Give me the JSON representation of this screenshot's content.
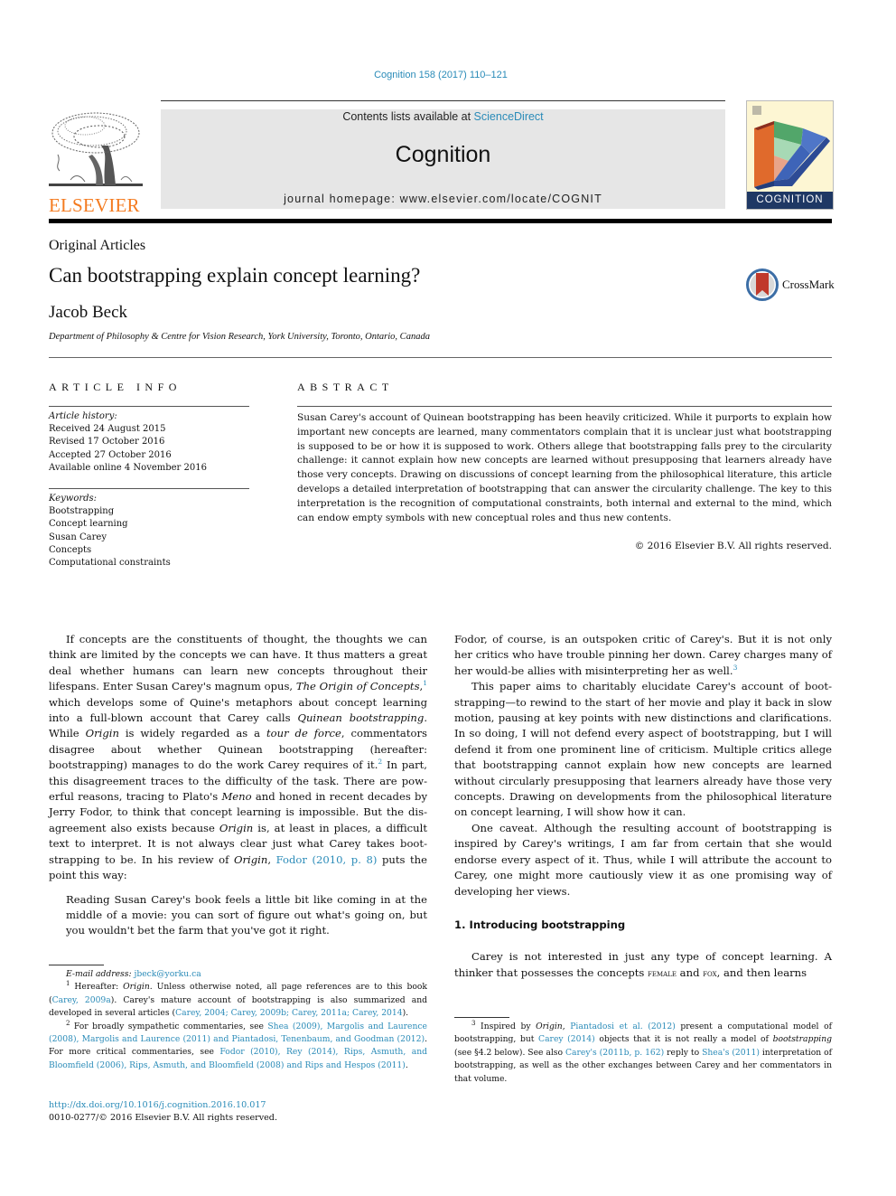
{
  "header": {
    "journal_ref": "Cognition 158 (2017) 110–121",
    "contents_prefix": "Contents lists available at ",
    "contents_link": "ScienceDirect",
    "journal_title": "Cognition",
    "homepage": "journal homepage: www.elsevier.com/locate/COGNIT",
    "publisher_logo_text": "ELSEVIER",
    "cover_label": "COGNITION",
    "colors": {
      "link": "#2a8bb8",
      "elsevier_orange": "#f47b20",
      "cover_navy": "#1f3864"
    }
  },
  "article": {
    "section_type": "Original Articles",
    "title": "Can bootstrapping explain concept learning?",
    "author": "Jacob Beck",
    "affiliation": "Department of Philosophy & Centre for Vision Research, York University, Toronto, Ontario, Canada",
    "crossmark_label": "CrossMark"
  },
  "article_info": {
    "heading": "ARTICLE INFO",
    "history_label": "Article history:",
    "history": [
      "Received 24 August 2015",
      "Revised 17 October 2016",
      "Accepted 27 October 2016",
      "Available online 4 November 2016"
    ],
    "keywords_label": "Keywords:",
    "keywords": [
      "Bootstrapping",
      "Concept learning",
      "Susan Carey",
      "Concepts",
      "Computational constraints"
    ]
  },
  "abstract": {
    "heading": "ABSTRACT",
    "text": "Susan Carey's account of Quinean bootstrapping has been heavily criticized. While it purports to explain how important new concepts are learned, many commentators complain that it is unclear just what boot­strapping is supposed to be or how it is supposed to work. Others allege that bootstrapping falls prey to the circularity challenge: it cannot explain how new concepts are learned without presupposing that learners already have those very concepts. Drawing on discussions of concept learning from the philo­sophical literature, this article develops a detailed interpretation of bootstrapping that can answer the circularity challenge. The key to this interpretation is the recognition of computational constraints, both internal and external to the mind, which can endow empty symbols with new conceptual roles and thus new contents.",
    "copyright": "© 2016 Elsevier B.V. All rights reserved."
  },
  "body": {
    "p1": {
      "a": "If concepts are the constituents of thought, the thoughts we can think are limited by the concepts we can have. It thus matters a great deal whether humans can learn new concepts throughout their lifespans. Enter Susan Carey's magnum opus, ",
      "b_i": "The Origin of Concepts",
      "c": ",",
      "fn1": "1",
      "d": " which develops some of Quine's metaphors about concept learning into a full-blown account that Carey calls ",
      "e_i": "Quinean bootstrap­ping",
      "f": ". While ",
      "g_i": "Origin",
      "h": " is widely regarded as a ",
      "i_i": "tour de force",
      "j": ", commenta­tors disagree about whether Quinean bootstrapping (hereafter: bootstrapping) manages to do the work Carey requires of it.",
      "fn2": "2",
      "k": " In part, this disagreement traces to the difficulty of the task. There are pow­erful reasons, tracing to Plato's ",
      "l_i": "Meno",
      "m": " and honed in recent decades by Jerry Fodor, to think that concept learning is impossible. But the dis­agreement also exists because ",
      "n_i": "Origin",
      "o": " is, at least in places, a difficult text to interpret. It is not always clear just what Carey takes boot­strapping to be. In his review of ",
      "p_i": "Origin",
      "q": ", ",
      "r_link": "Fodor (2010, p. 8)",
      "s": " puts the point this way:"
    },
    "quote": "Reading Susan Carey's book feels a little bit like coming in at the middle of a movie: you can sort of figure out what's going on, but you wouldn't bet the farm that you've got it right.",
    "p2": {
      "a": "Fodor, of course, is an outspoken critic of Carey's. But it is not only her critics who have trouble pinning her down. Carey charges many of her would-be allies with misinterpreting her as well.",
      "fn3": "3"
    },
    "p3": "This paper aims to charitably elucidate Carey's account of boot­strapping—to rewind to the start of her movie and play it back in slow motion, pausing at key points with new distinctions and clar­ifications. In so doing, I will not defend every aspect of bootstrap­ping, but I will defend it from one prominent line of criticism. Multiple critics allege that bootstrapping cannot explain how new concepts are learned without circularly presupposing that learners already have those very concepts. Drawing on develop­ments from the philosophical literature on concept learning, I will show how it can.",
    "p4": "One caveat. Although the resulting account of bootstrapping is inspired by Carey's writings, I am far from certain that she would endorse every aspect of it. Thus, while I will attribute the account to Carey, one might more cautiously view it as one promising way of developing her views.",
    "section1_heading": "1. Introducing bootstrapping",
    "p5": {
      "a": "Carey is not interested in just any type of concept learning. A thinker that possesses the concepts ",
      "sc1": "female",
      "b": " and ",
      "sc2": "fox",
      "c": ", and then learns"
    }
  },
  "footnotes": {
    "email_label": "E-mail address: ",
    "email": "jbeck@yorku.ca",
    "fn1": {
      "num": "1",
      "a": " Hereafter: ",
      "b_i": "Origin",
      "c": ". Unless otherwise noted, all page references are to this book (",
      "d_link": "Carey, 2009a",
      "e": "). Carey's mature account of bootstrapping is also summarized and developed in several articles (",
      "f_link": "Carey, 2004; Carey, 2009b; Carey, 2011a; Carey, 2014",
      "g": ")."
    },
    "fn2": {
      "num": "2",
      "a": " For broadly sympathetic commentaries, see ",
      "b_link": "Shea (2009), Margolis and Laurence (2008), Margolis and Laurence (2011) and Piantadosi, Tenenbaum, and Goodman (2012)",
      "c": ". For more critical commentaries, see ",
      "d_link": "Fodor (2010), Rey (2014), Rips, Asmuth, and Bloomfield (2006), Rips, Asmuth, and Bloomfield (2008) and Rips and Hespos (2011)",
      "e": "."
    },
    "fn3": {
      "num": "3",
      "a": " Inspired by ",
      "b_i": "Origin",
      "c": ", ",
      "d_link": "Piantadosi et al. (2012)",
      "e": " present a computational model of bootstrapping, but ",
      "f_link": "Carey (2014)",
      "g": " objects that it is not really a model of ",
      "h_i": "bootstrapping",
      "i": " (see §4.2 below). See also ",
      "j_link": "Carey's (2011b, p. 162)",
      "k": " reply to ",
      "l_link": "Shea's (2011)",
      "m": " interpretation of bootstrapping, as well as the other exchanges between Carey and her commen­tators in that volume."
    }
  },
  "footer": {
    "doi": "http://dx.doi.org/10.1016/j.cognition.2016.10.017",
    "issn_copyright": "0010-0277/© 2016 Elsevier B.V. All rights reserved."
  }
}
